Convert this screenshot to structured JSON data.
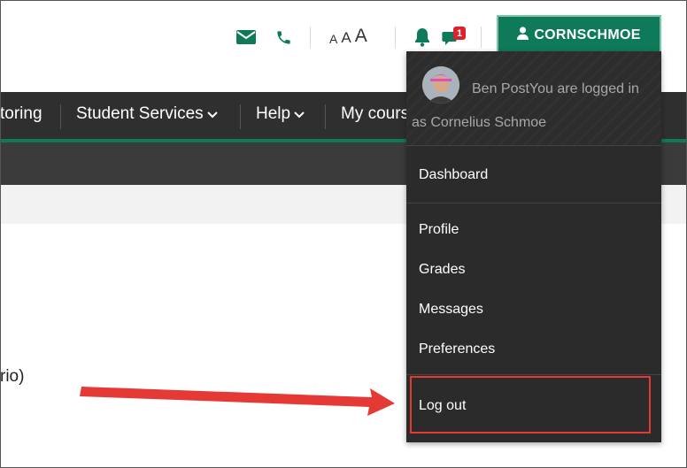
{
  "header": {
    "font_sizes": [
      "A",
      "A",
      "A"
    ],
    "notification_count": "1",
    "user_button_label": "CORNSCHMOE"
  },
  "nav": {
    "items": [
      {
        "label": "toring"
      },
      {
        "label": "Student Services",
        "has_chevron": true
      },
      {
        "label": "Help",
        "has_chevron": true
      },
      {
        "label": "My cours"
      }
    ]
  },
  "page": {
    "body_fragment": "rio)"
  },
  "user_menu": {
    "header_text": "Ben PostYou are logged in as Cornelius Schmoe",
    "items": [
      "Dashboard",
      "Profile",
      "Grades",
      "Messages",
      "Preferences",
      "Log out"
    ],
    "highlighted_item": "Log out"
  },
  "colors": {
    "accent": "#0f7a5a",
    "nav_bg": "#2f2f2f",
    "menu_bg": "#2b2b2b",
    "highlight": "#e53935",
    "badge": "#d9232d"
  },
  "icons": {
    "mail": "envelope-icon",
    "phone": "phone-icon",
    "bell": "bell-icon",
    "chat": "chat-icon",
    "user": "user-icon",
    "chevron": "chevron-down-icon"
  }
}
